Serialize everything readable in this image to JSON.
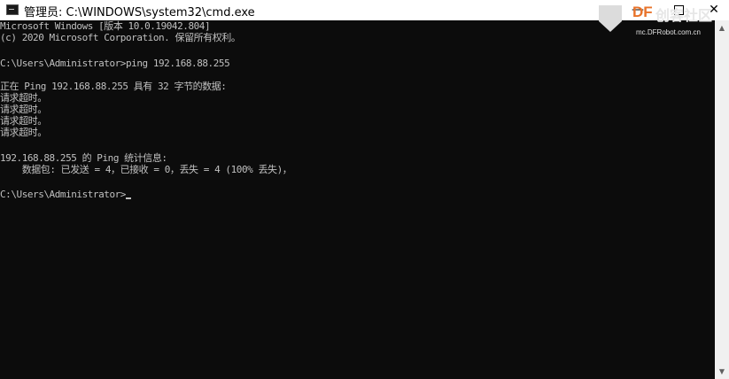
{
  "window": {
    "title": "管理员: C:\\WINDOWS\\system32\\cmd.exe",
    "minimize_label": "—",
    "close_label": "✕"
  },
  "console": {
    "lines": [
      "Microsoft Windows [版本 10.0.19042.804]",
      "(c) 2020 Microsoft Corporation. 保留所有权利。",
      "",
      "C:\\Users\\Administrator>ping 192.168.88.255",
      "",
      "正在 Ping 192.168.88.255 具有 32 字节的数据:",
      "请求超时。",
      "请求超时。",
      "请求超时。",
      "请求超时。",
      "",
      "192.168.88.255 的 Ping 统计信息:",
      "    数据包: 已发送 = 4，已接收 = 0，丢失 = 4 (100% 丢失)，",
      "",
      "C:\\Users\\Administrator>"
    ]
  },
  "watermark": {
    "brand": "DF",
    "brand_cn": "创客社区",
    "url": "mc.DFRobot.com.cn"
  },
  "colors": {
    "console_bg": "#0c0c0c",
    "console_text": "#c0c0c0",
    "brand_orange": "#e8732a"
  },
  "icons": [
    "cmd-icon",
    "minimize-icon",
    "maximize-icon",
    "close-icon",
    "scroll-up-icon",
    "scroll-down-icon"
  ]
}
